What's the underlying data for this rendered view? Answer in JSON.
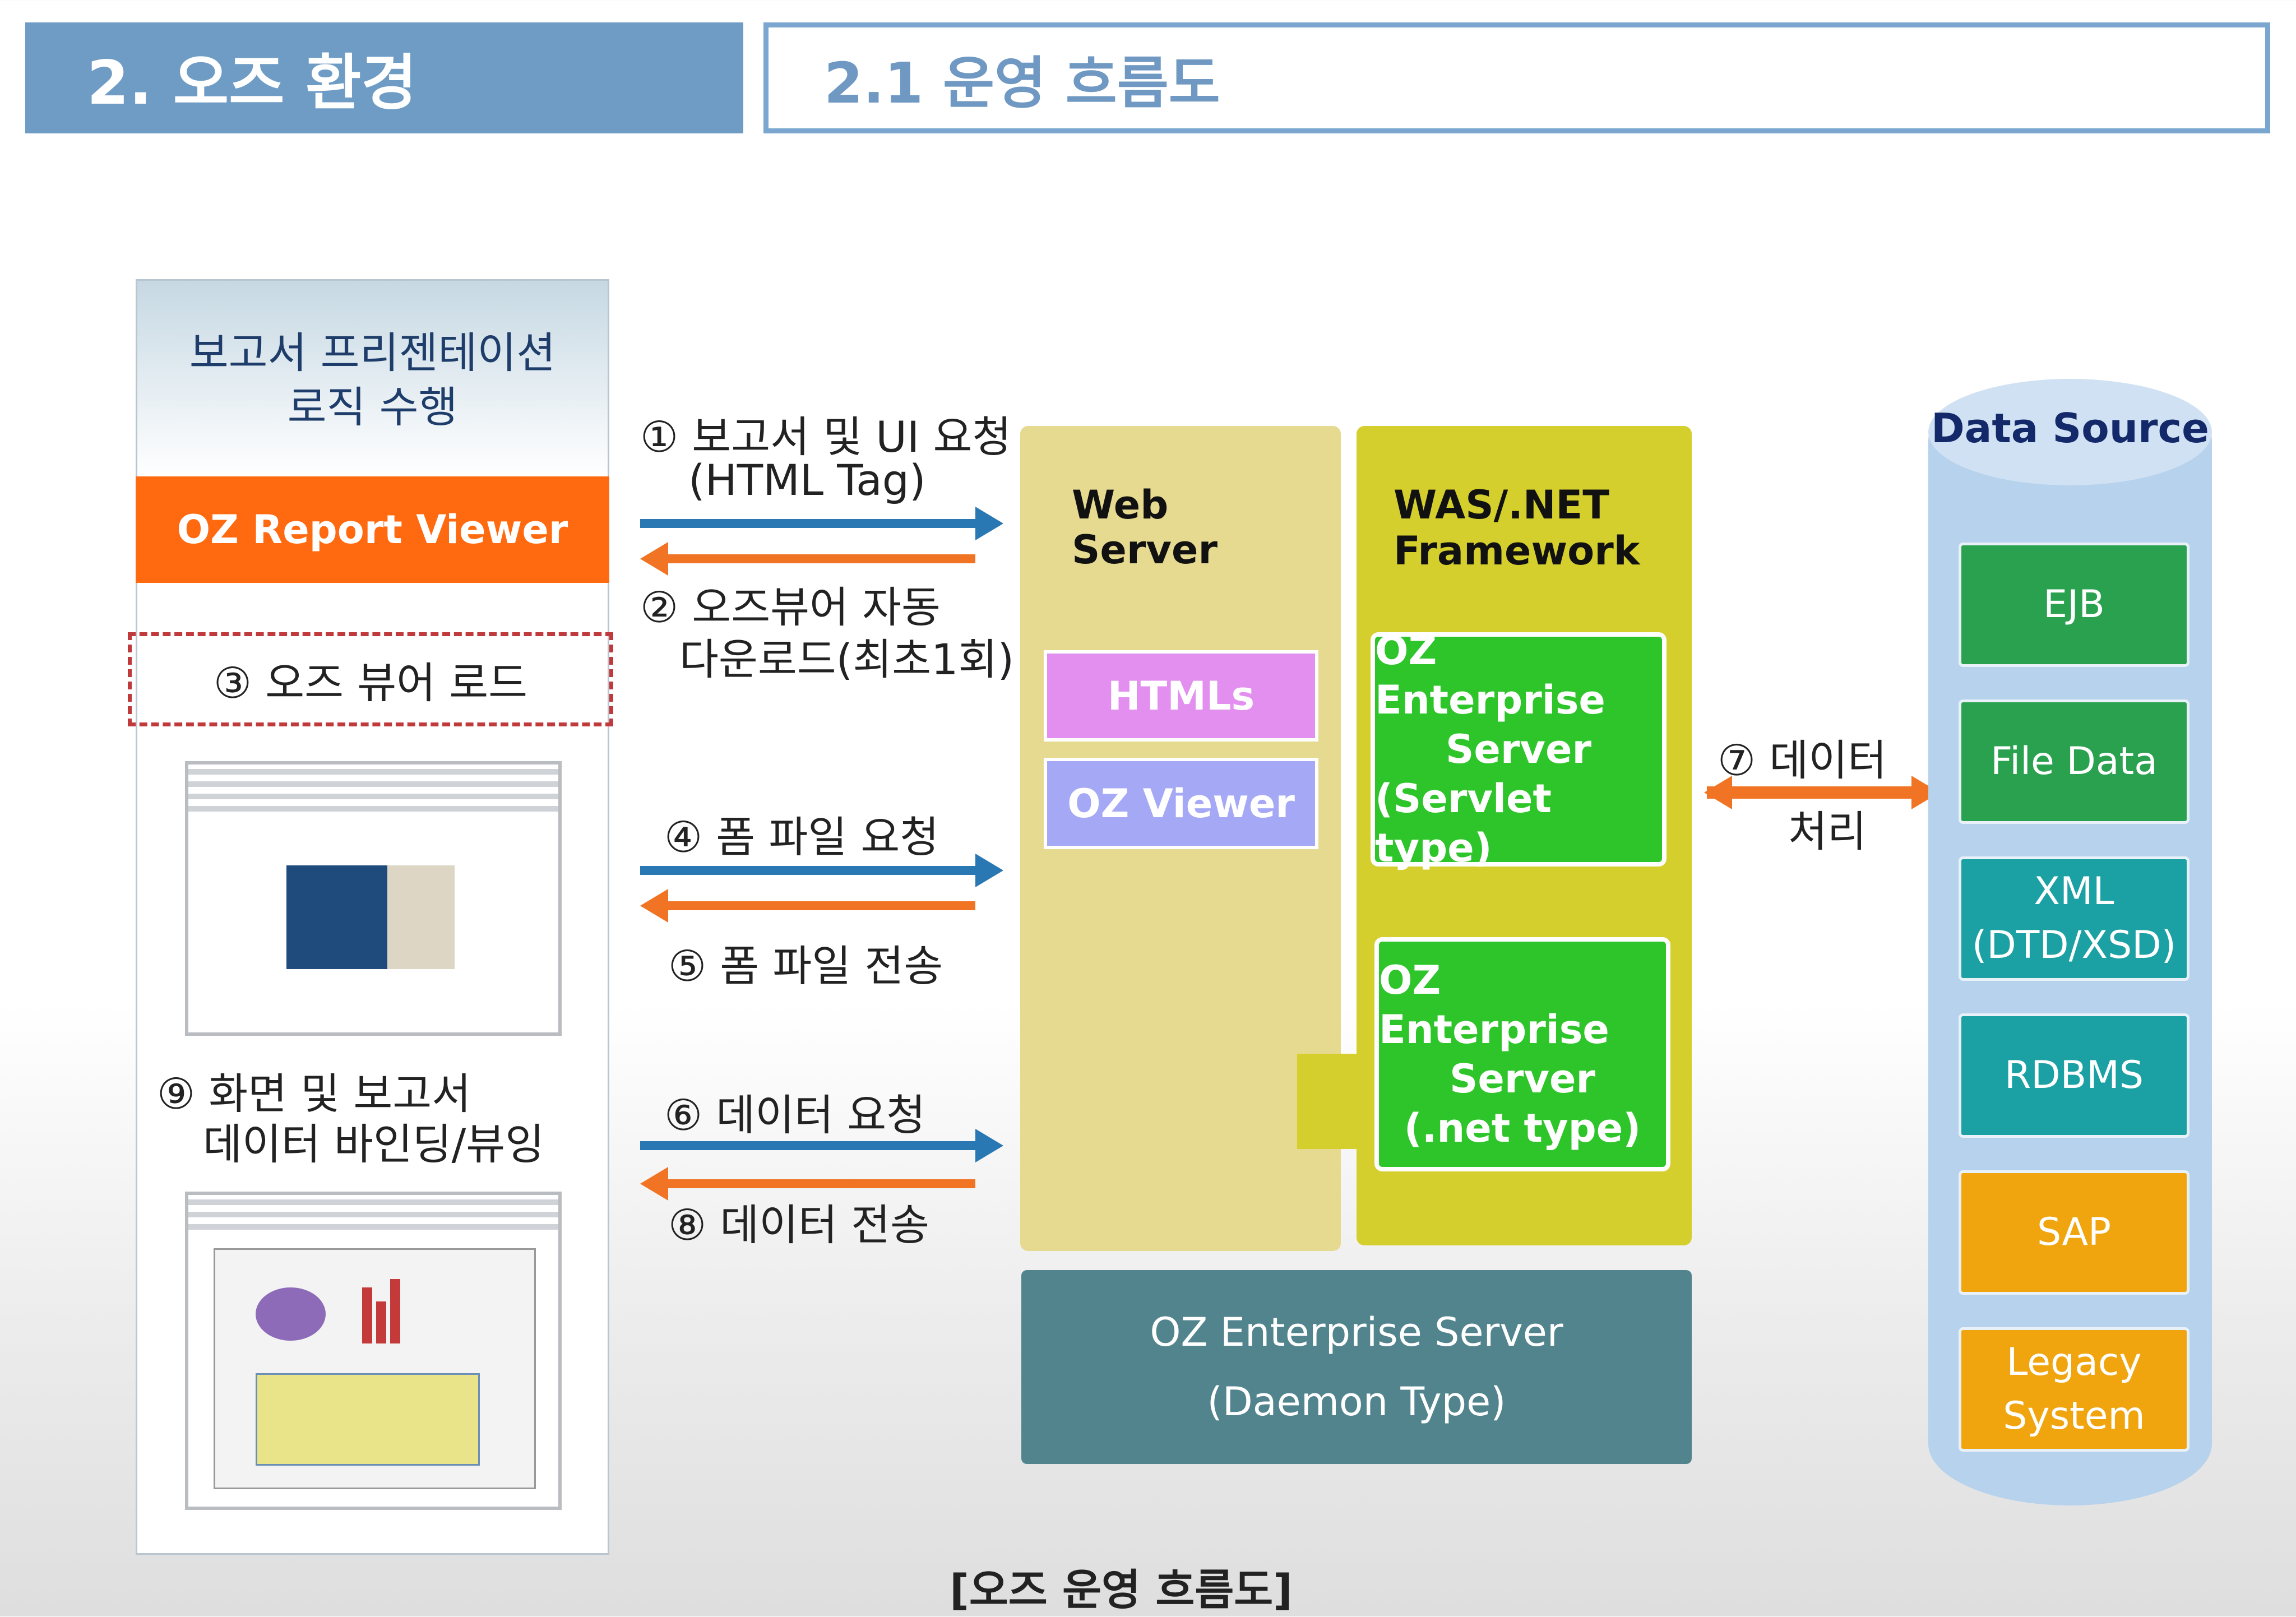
{
  "header": {
    "section": "2. 오즈 환경",
    "subsection": "2.1 운영 흐름도"
  },
  "left": {
    "logic_line1": "보고서 프리젠테이션",
    "logic_line2": "로직 수행",
    "viewer": "OZ Report Viewer",
    "step3": "③ 오즈 뷰어 로드",
    "step9_line1": "⑨ 화면 및 보고서",
    "step9_line2": "데이터 바인딩/뷰잉"
  },
  "flows": {
    "step1_line1": "① 보고서 및 UI 요청",
    "step1_line2": "(HTML Tag)",
    "step2_line1": "② 오즈뷰어 자동",
    "step2_line2": "다운로드(최초1회)",
    "step4": "④ 폼 파일 요청",
    "step5": "⑤ 폼 파일 전송",
    "step6": "⑥ 데이터 요청",
    "step8": "⑧ 데이터 전송",
    "step7_line1": "⑦ 데이터",
    "step7_line2": "처리"
  },
  "web_server": {
    "title_line1": "Web",
    "title_line2": "Server",
    "htmls": "HTMLs",
    "oz_viewer": "OZ Viewer"
  },
  "was": {
    "title_line1": "WAS/.NET",
    "title_line2": "Framework",
    "servlet_line1": "OZ Enterprise",
    "servlet_line2": "Server",
    "servlet_line3": "(Servlet type)",
    "net_line1": "OZ Enterprise",
    "net_line2": "Server",
    "net_line3": "(.net type)"
  },
  "daemon": {
    "line1": "OZ Enterprise Server",
    "line2": "(Daemon Type)"
  },
  "data_source": {
    "title": "Data Source",
    "items": [
      {
        "line1": "EJB",
        "line2": ""
      },
      {
        "line1": "File Data",
        "line2": ""
      },
      {
        "line1": "XML",
        "line2": "(DTD/XSD)"
      },
      {
        "line1": "RDBMS",
        "line2": ""
      },
      {
        "line1": "SAP",
        "line2": ""
      },
      {
        "line1": "Legacy",
        "line2": "System"
      }
    ]
  },
  "caption": "[오즈 운영 흐름도]",
  "colors": {
    "header_bar": "#6e9cc5",
    "viewer_orange": "#ff6a10",
    "arrow_blue": "#2a78b3",
    "arrow_orange": "#f07424",
    "web_server": "#e6da91",
    "was": "#d4cf2c",
    "server_green": "#2ec52a",
    "daemon": "#52848e"
  }
}
